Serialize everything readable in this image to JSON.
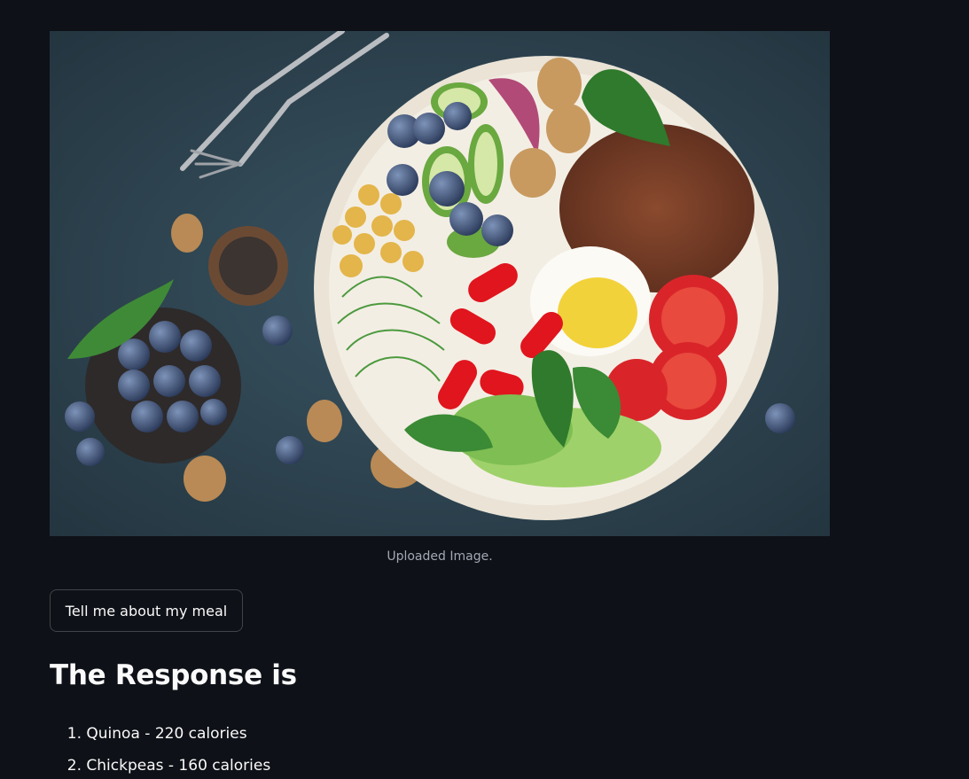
{
  "image": {
    "caption": "Uploaded Image.",
    "icon": "meal-photo"
  },
  "button": {
    "label": "Tell me about my meal"
  },
  "response": {
    "heading": "The Response is",
    "items": [
      {
        "number": "1.",
        "text": "Quinoa - 220 calories"
      },
      {
        "number": "2.",
        "text": "Chickpeas - 160 calories"
      }
    ]
  },
  "colors": {
    "background": "#0e1117",
    "text": "#fafafa",
    "caption": "#a3a8b4"
  }
}
